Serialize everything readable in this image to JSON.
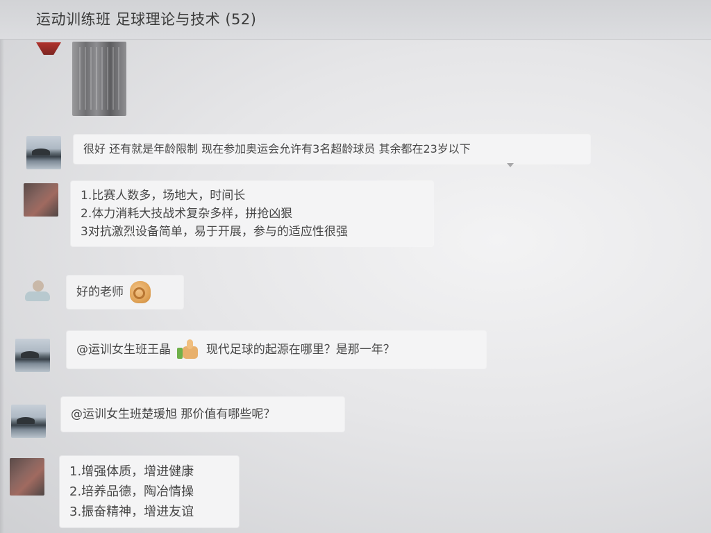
{
  "header": {
    "title": "运动训练班 足球理论与技术 (52)"
  },
  "messages": [
    {
      "type": "image",
      "sender_avatar": "red-shirt-avatar"
    },
    {
      "type": "text",
      "sender_avatar": "seascape-avatar",
      "text": "很好 还有就是年龄限制 现在参加奥运会允许有3名超龄球员 其余都在23岁以下"
    },
    {
      "type": "text",
      "sender_avatar": "photo-avatar",
      "lines": [
        "1.比赛人数多，场地大，时间长",
        "2.体力消耗大技战术复杂多样，拼抢凶狠",
        "3对抗激烈设备简单，易于开展，参与的适应性很强"
      ]
    },
    {
      "type": "text",
      "sender_avatar": "cartoon-avatar",
      "text": "好的老师",
      "emoji": "ok-hand-emoji"
    },
    {
      "type": "text",
      "sender_avatar": "seascape-avatar",
      "mention": "@运训女生班王晶",
      "emoji": "thumbs-up-emoji",
      "text": "现代足球的起源在哪里？是那一年？"
    },
    {
      "type": "text",
      "sender_avatar": "seascape-avatar",
      "text": "@运训女生班楚瑗旭 那价值有哪些呢？"
    },
    {
      "type": "text",
      "sender_avatar": "photo-avatar",
      "lines": [
        "1.增强体质，增进健康",
        "2.培养品德，陶冶情操",
        "3.振奋精神，增进友谊"
      ]
    }
  ]
}
